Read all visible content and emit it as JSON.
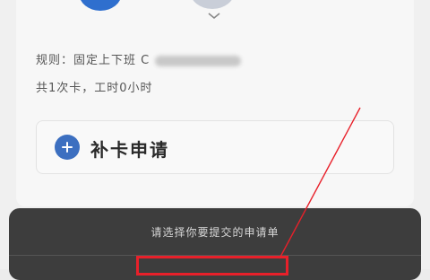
{
  "rule": {
    "label": "规则：",
    "shift_type": "固定上下班 C"
  },
  "summary": {
    "text": "共1次卡，工时0小时"
  },
  "apply": {
    "label": "补卡申请"
  },
  "sheet": {
    "title": "请选择你要提交的申请单"
  },
  "colors": {
    "accent": "#2f6fce",
    "annotation": "#e8202a"
  }
}
